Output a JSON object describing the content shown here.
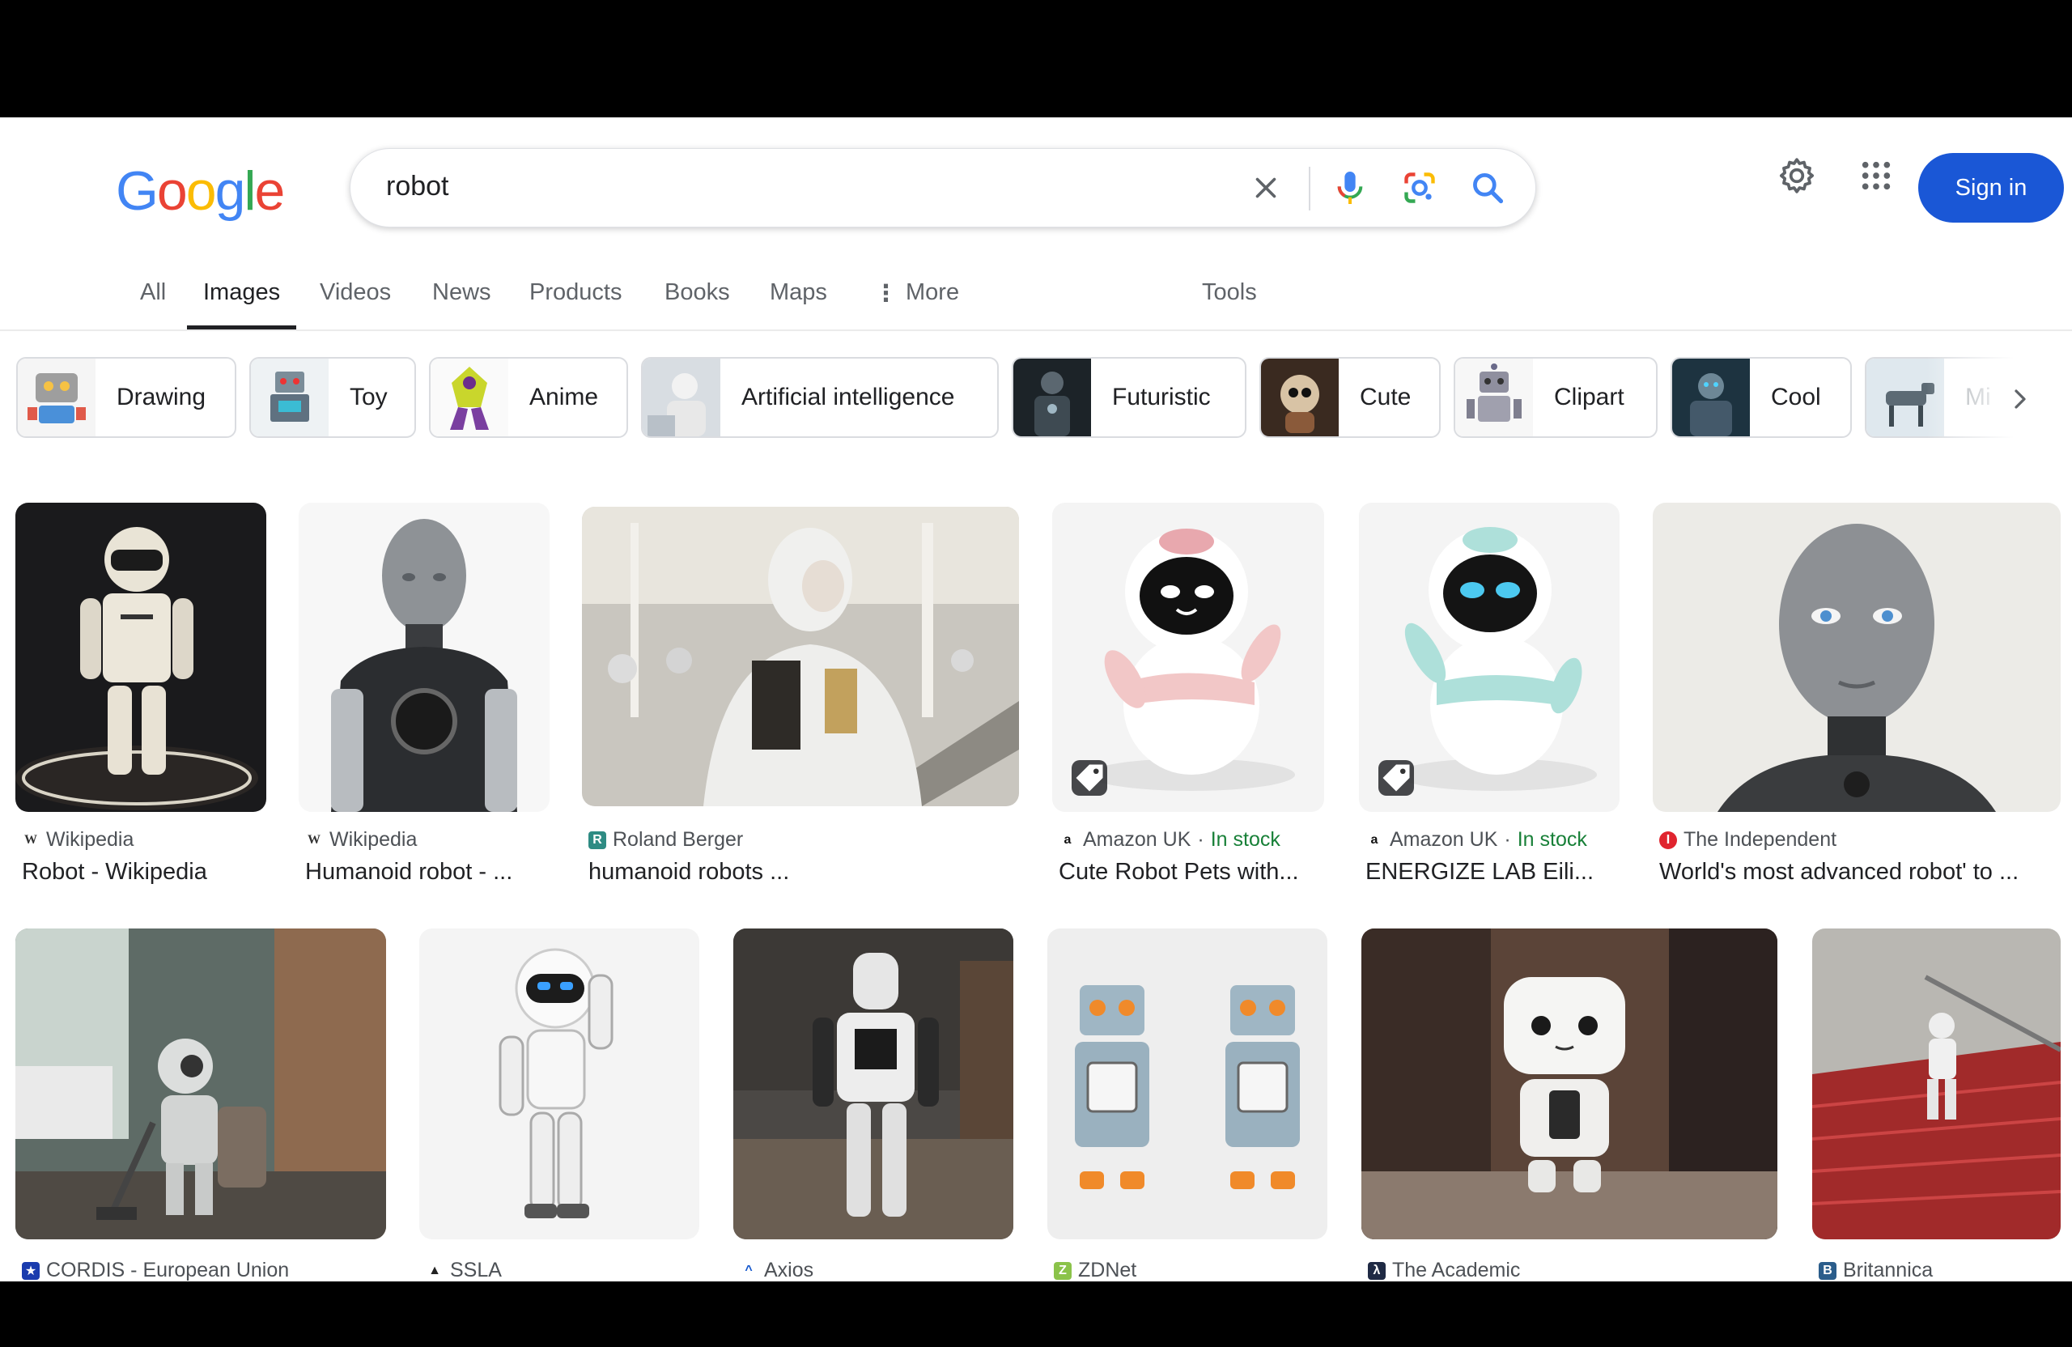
{
  "search": {
    "query": "robot"
  },
  "header": {
    "sign_in": "Sign in"
  },
  "logo": {
    "letters": [
      "G",
      "o",
      "o",
      "g",
      "l",
      "e"
    ],
    "colors": [
      "#4285F4",
      "#EA4335",
      "#FBBC05",
      "#4285F4",
      "#34A853",
      "#EA4335"
    ]
  },
  "tabs": [
    {
      "label": "All"
    },
    {
      "label": "Images",
      "active": true
    },
    {
      "label": "Videos"
    },
    {
      "label": "News"
    },
    {
      "label": "Products"
    },
    {
      "label": "Books"
    },
    {
      "label": "Maps"
    },
    {
      "label": "More"
    }
  ],
  "tools_label": "Tools",
  "chips": [
    {
      "label": "Drawing"
    },
    {
      "label": "Toy"
    },
    {
      "label": "Anime"
    },
    {
      "label": "Artificial intelligence"
    },
    {
      "label": "Futuristic"
    },
    {
      "label": "Cute"
    },
    {
      "label": "Clipart"
    },
    {
      "label": "Cool"
    },
    {
      "label": "Mi"
    }
  ],
  "results": [
    {
      "source": "Wikipedia",
      "title": "Robot - Wikipedia"
    },
    {
      "source": "Wikipedia",
      "title": "Humanoid robot - ..."
    },
    {
      "source": "Roland Berger",
      "title": "humanoid robots ..."
    },
    {
      "source": "Amazon UK",
      "stock": "In stock",
      "title": "Cute Robot Pets with..."
    },
    {
      "source": "Amazon UK",
      "stock": "In stock",
      "title": "ENERGIZE LAB Eili..."
    },
    {
      "source": "The Independent",
      "title": "World's most advanced robot' to ..."
    },
    {
      "source": "CORDIS - European Union"
    },
    {
      "source": "SSLA"
    },
    {
      "source": "Axios"
    },
    {
      "source": "ZDNet"
    },
    {
      "source": "The Academic"
    },
    {
      "source": "Britannica"
    }
  ],
  "product_text": {
    "eilik": "Eilik",
    "separator": "·"
  },
  "colors": {
    "accent": "#1a57d6",
    "in_stock": "#188038"
  }
}
